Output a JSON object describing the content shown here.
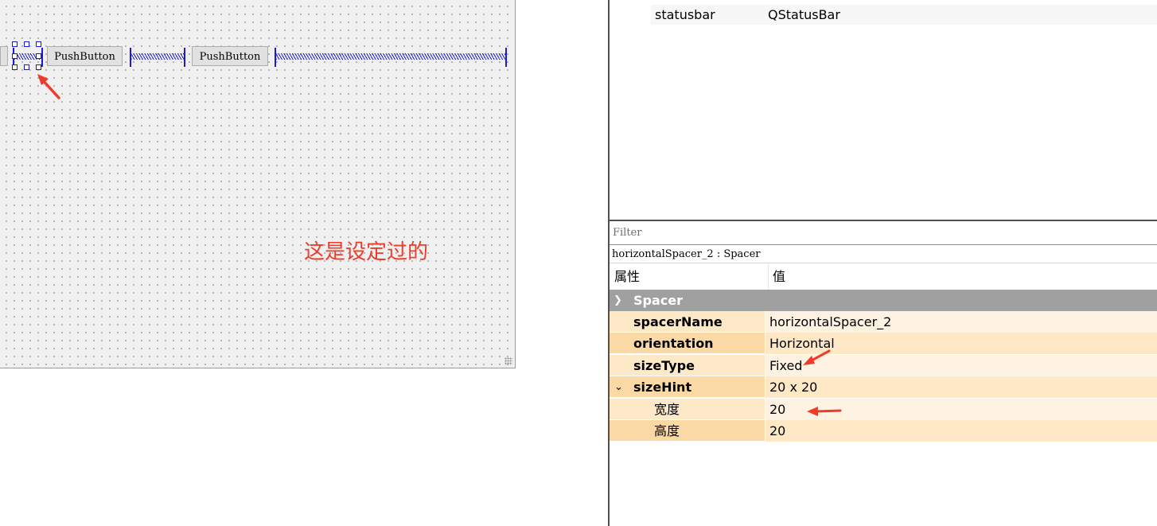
{
  "designer": {
    "push_button_label": "PushButton",
    "push_button_2_label": "PushButton",
    "annotation": "这是设定过的"
  },
  "object_inspector": {
    "row": {
      "name": "statusbar",
      "class": "QStatusBar"
    }
  },
  "property_editor": {
    "filter_placeholder": "Filter",
    "object_label": "horizontalSpacer_2 : Spacer",
    "col_property": "属性",
    "col_value": "值",
    "group": "Spacer",
    "props": {
      "spacerName": {
        "label": "spacerName",
        "value": "horizontalSpacer_2"
      },
      "orientation": {
        "label": "orientation",
        "value": "Horizontal"
      },
      "sizeType": {
        "label": "sizeType",
        "value": "Fixed"
      },
      "sizeHint": {
        "label": "sizeHint",
        "value": "20 x 20"
      },
      "width": {
        "label": "宽度",
        "value": "20"
      },
      "height": {
        "label": "高度",
        "value": "20"
      }
    }
  },
  "colors": {
    "annotation_red": "#ee3b2a",
    "spacer_blue": "#1a1ad8",
    "group_header": "#a0a0a0",
    "property_row": "#fde9c8"
  }
}
